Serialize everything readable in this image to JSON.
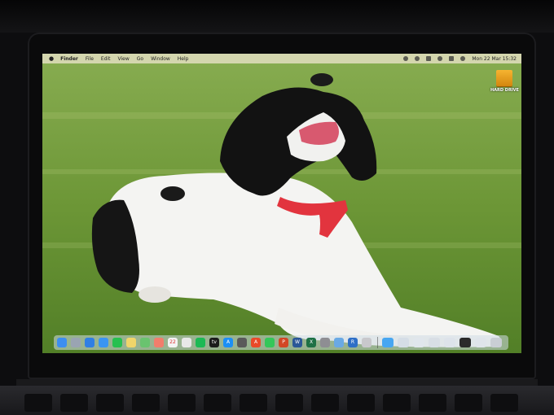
{
  "menubar": {
    "apple": "",
    "items": [
      "Finder",
      "File",
      "Edit",
      "View",
      "Go",
      "Window",
      "Help"
    ],
    "clock": "Mon 22 Mar  15:32",
    "tray_icons": [
      "screen-record-icon",
      "focus-icon",
      "wifi-icon",
      "search-icon",
      "control-center-icon",
      "siri-icon"
    ]
  },
  "desktop": {
    "drive_label": "HARD DRIVE"
  },
  "dock": {
    "apps": [
      {
        "name": "finder-icon",
        "color": "#3d8ef0",
        "glyph": ""
      },
      {
        "name": "launchpad-icon",
        "color": "#9aa4b2",
        "glyph": ""
      },
      {
        "name": "safari-icon",
        "color": "#2f7fe4",
        "glyph": ""
      },
      {
        "name": "mail-icon",
        "color": "#3a95f2",
        "glyph": ""
      },
      {
        "name": "whatsapp-icon",
        "color": "#27c04f",
        "glyph": ""
      },
      {
        "name": "notes-icon",
        "color": "#f0d56a",
        "glyph": ""
      },
      {
        "name": "maps-icon",
        "color": "#6ac36f",
        "glyph": ""
      },
      {
        "name": "photos-icon",
        "color": "#f27d6c",
        "glyph": ""
      },
      {
        "name": "calendar-icon",
        "color": "#f3f3f3",
        "glyph": "22"
      },
      {
        "name": "reminders-icon",
        "color": "#e8e8e8",
        "glyph": ""
      },
      {
        "name": "spotify-icon",
        "color": "#1db954",
        "glyph": ""
      },
      {
        "name": "apple-tv-icon",
        "color": "#1b1b1b",
        "glyph": "tv"
      },
      {
        "name": "app-store-icon",
        "color": "#1c8ff5",
        "glyph": "A"
      },
      {
        "name": "calculator-icon",
        "color": "#5a5a5a",
        "glyph": ""
      },
      {
        "name": "adobe-acrobat-icon",
        "color": "#e94a2a",
        "glyph": "A"
      },
      {
        "name": "messages-icon",
        "color": "#34c759",
        "glyph": ""
      },
      {
        "name": "powerpoint-icon",
        "color": "#d24726",
        "glyph": "P"
      },
      {
        "name": "word-icon",
        "color": "#2b5797",
        "glyph": "W"
      },
      {
        "name": "excel-icon",
        "color": "#1e7145",
        "glyph": "X"
      },
      {
        "name": "system-preferences-icon",
        "color": "#8e8e93",
        "glyph": ""
      },
      {
        "name": "preview-icon",
        "color": "#6aa9e4",
        "glyph": ""
      },
      {
        "name": "r-icon",
        "color": "#2f6fc7",
        "glyph": "R"
      },
      {
        "name": "script-editor-icon",
        "color": "#c8c8cc",
        "glyph": ""
      }
    ],
    "stacks": [
      {
        "name": "folder-icon",
        "color": "#47a6f1"
      },
      {
        "name": "window-thumb-icon",
        "color": "#d5dde6"
      },
      {
        "name": "window-thumb-icon",
        "color": "#e0e6ec"
      },
      {
        "name": "window-thumb-icon",
        "color": "#d8dee5"
      },
      {
        "name": "window-thumb-icon",
        "color": "#dde3ea"
      },
      {
        "name": "window-thumb-icon",
        "color": "#2a2a2a"
      },
      {
        "name": "window-thumb-icon",
        "color": "#dfe4ea"
      },
      {
        "name": "trash-icon",
        "color": "#c9ced4"
      }
    ]
  }
}
